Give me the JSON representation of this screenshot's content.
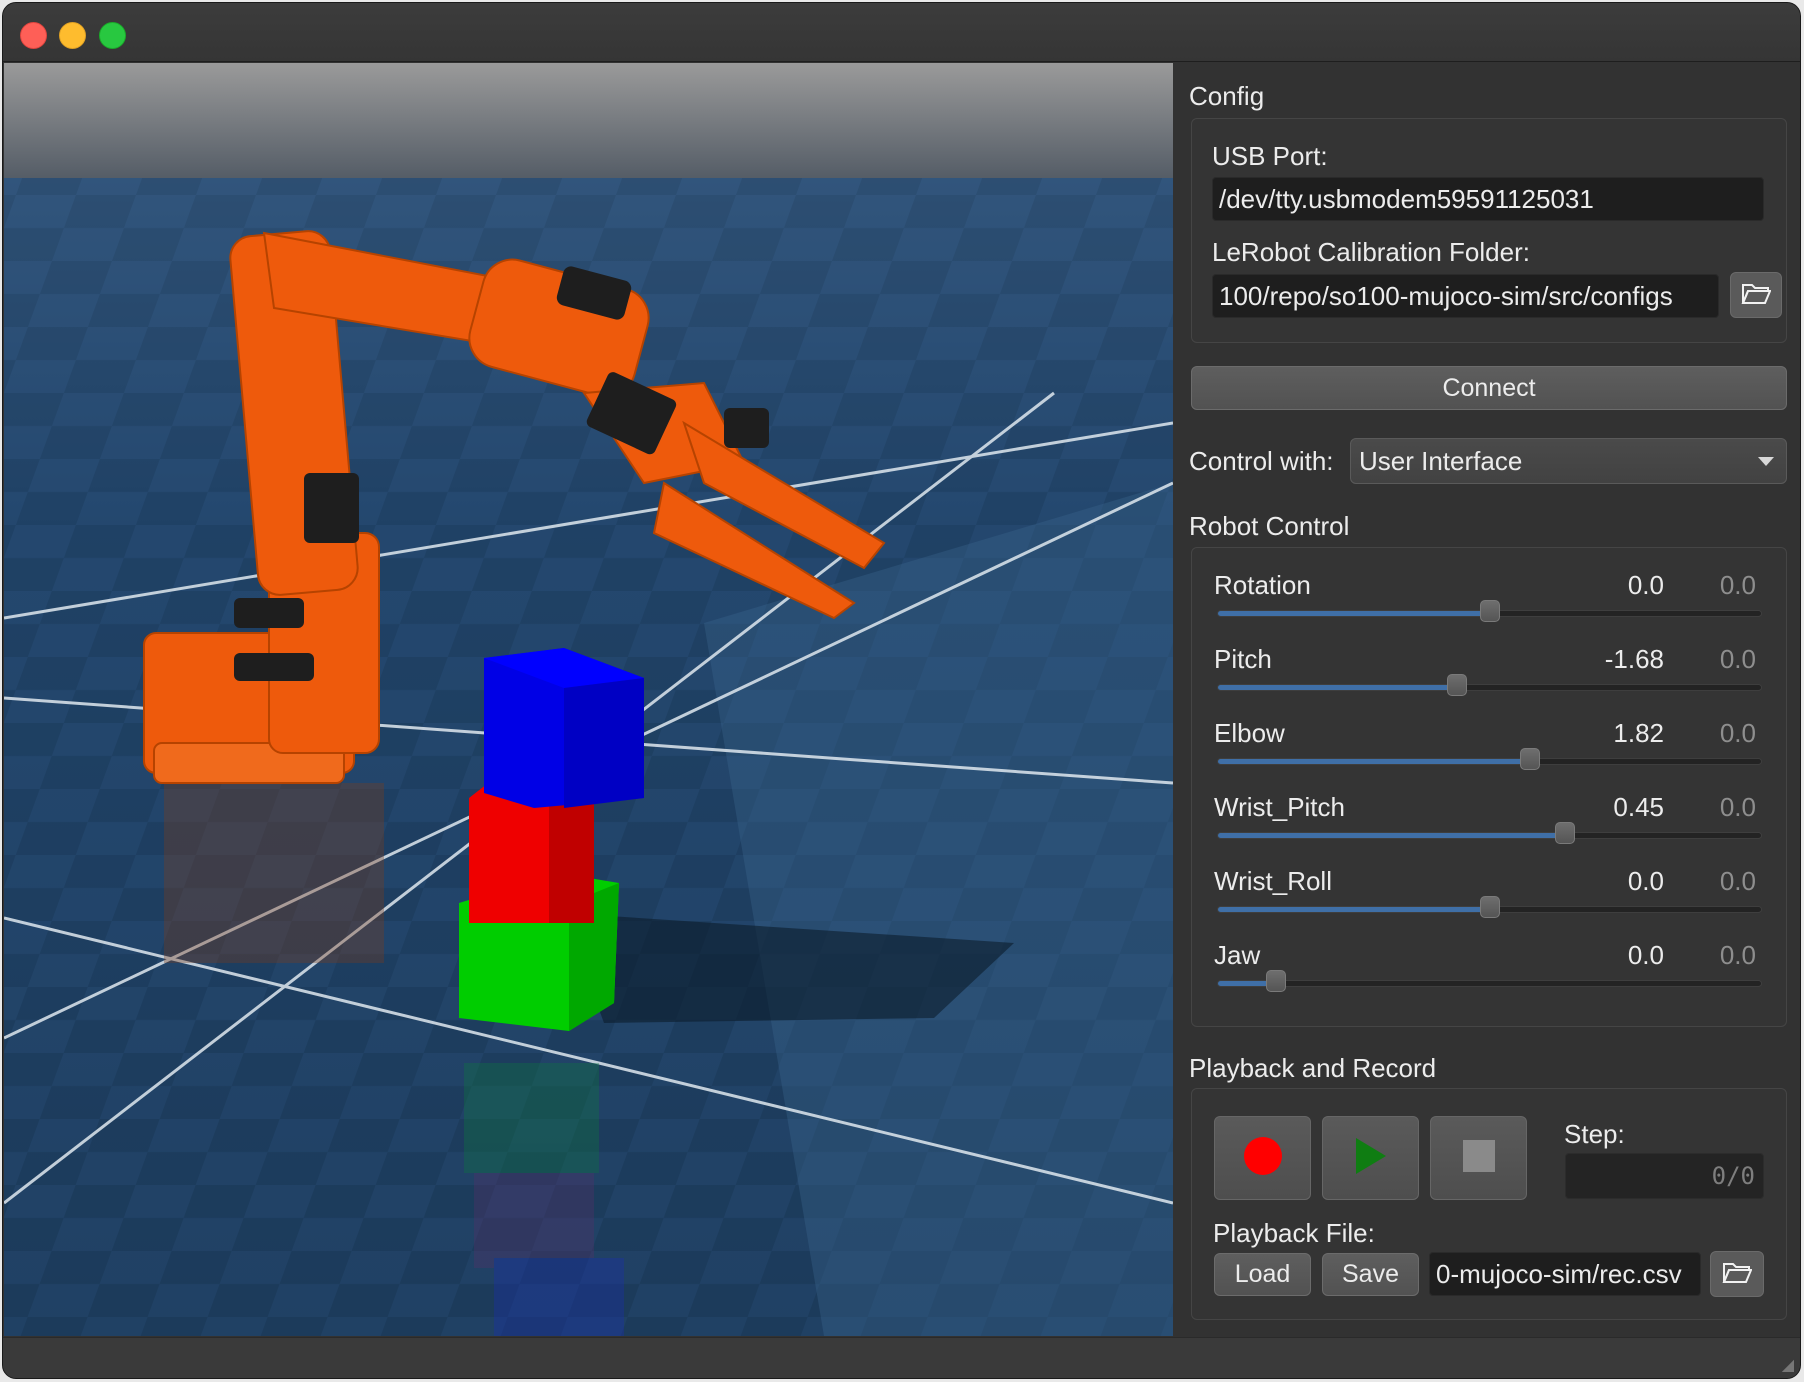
{
  "config": {
    "title": "Config",
    "usb_port_label": "USB Port:",
    "usb_port_value": "/dev/tty.usbmodem59591125031",
    "calib_label": "LeRobot Calibration Folder:",
    "calib_value": "100/repo/so100-mujoco-sim/src/configs",
    "browse_icon": "folder-open-icon"
  },
  "connect_label": "Connect",
  "control": {
    "label": "Control with:",
    "selected": "User Interface"
  },
  "robot_control": {
    "title": "Robot Control",
    "joints": [
      {
        "name": "Rotation",
        "value": "0.0",
        "target": "0.0",
        "position": 0.5
      },
      {
        "name": "Pitch",
        "value": "-1.68",
        "target": "0.0",
        "position": 0.44
      },
      {
        "name": "Elbow",
        "value": "1.82",
        "target": "0.0",
        "position": 0.575
      },
      {
        "name": "Wrist_Pitch",
        "value": "0.45",
        "target": "0.0",
        "position": 0.638
      },
      {
        "name": "Wrist_Roll",
        "value": "0.0",
        "target": "0.0",
        "position": 0.5
      },
      {
        "name": "Jaw",
        "value": "0.0",
        "target": "0.0",
        "position": 0.108
      }
    ]
  },
  "playback": {
    "title": "Playback and Record",
    "record_icon": "record-icon",
    "play_icon": "play-icon",
    "stop_icon": "stop-icon",
    "step_label": "Step:",
    "step_value": "0/0",
    "file_label": "Playback File:",
    "load_label": "Load",
    "save_label": "Save",
    "file_value": "0-mujoco-sim/rec.csv"
  },
  "colors": {
    "accent": "#3f6fa7",
    "robot": "#ee5a0c",
    "record": "#ff0000",
    "play": "#0f7d12"
  }
}
